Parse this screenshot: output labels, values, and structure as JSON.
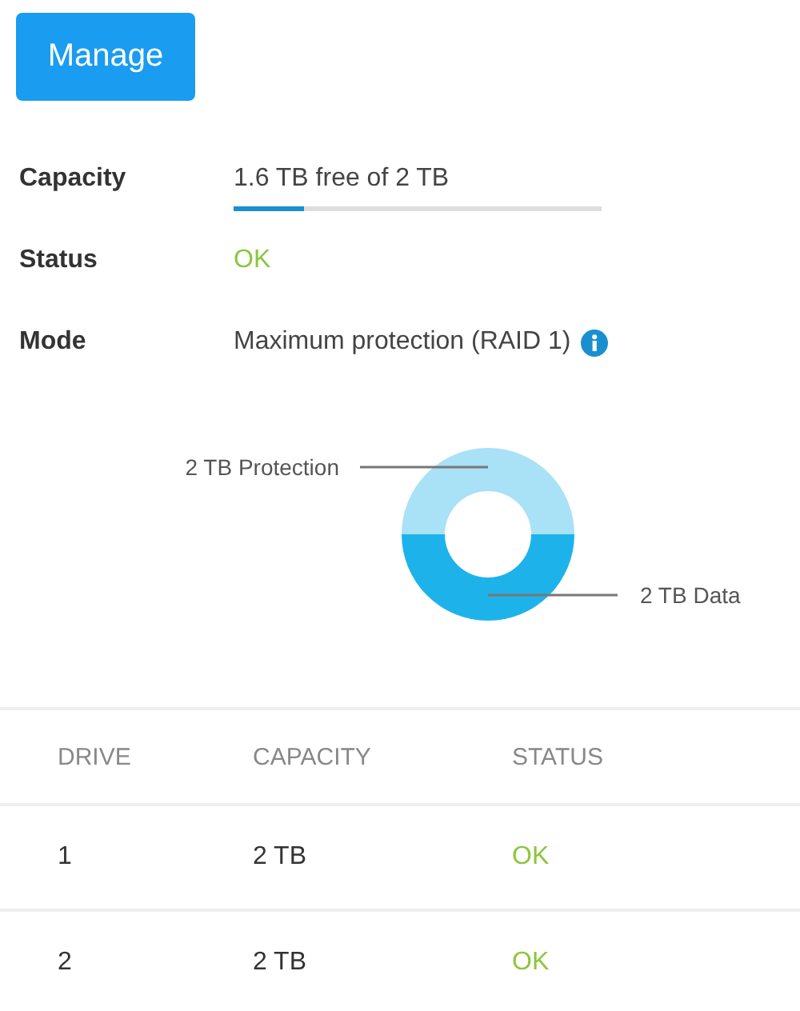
{
  "manage_button": {
    "label": "Manage"
  },
  "details": [
    {
      "kind": "meter",
      "label": "Capacity",
      "value": "1.6 TB free of 2 TB",
      "level": 0.19
    },
    {
      "kind": "status",
      "label": "Status",
      "value": "OK"
    },
    {
      "kind": "info",
      "label": "Mode",
      "value": "Maximum protection (RAID 1)"
    }
  ],
  "chart_data": {
    "type": "donut",
    "categories": [
      "2 TB Protection",
      "2 TB Data"
    ],
    "values": [
      2,
      2
    ]
  },
  "table": {
    "columns": [
      "DRIVE",
      "CAPACITY",
      "STATUS"
    ],
    "rows": [
      [
        "1",
        "2 TB",
        "OK"
      ],
      [
        "2",
        "2 TB",
        "OK"
      ]
    ]
  }
}
